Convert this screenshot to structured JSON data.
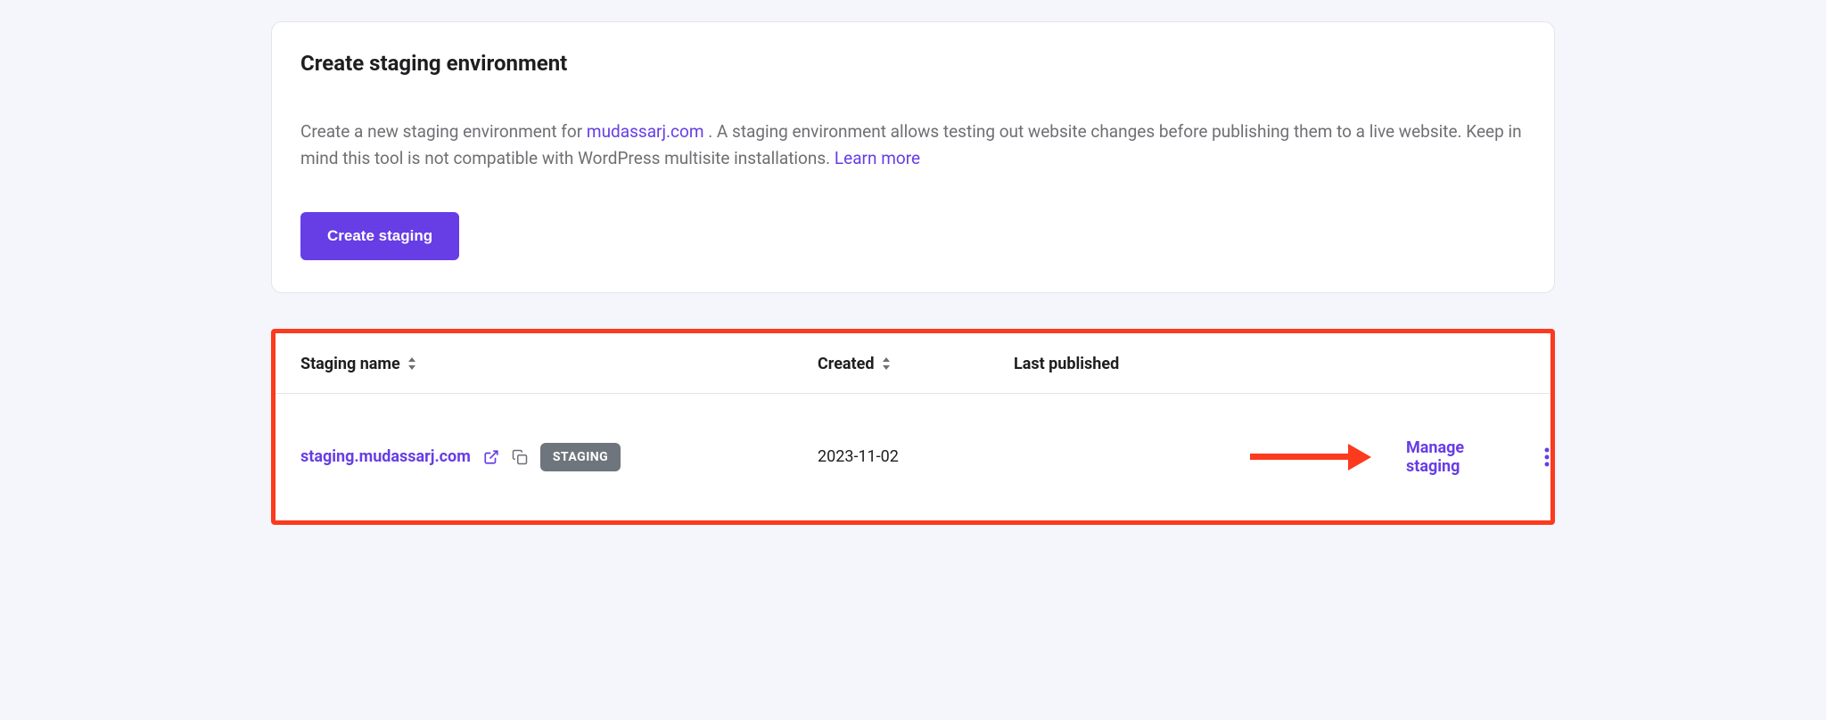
{
  "card": {
    "title": "Create staging environment",
    "desc_prefix": "Create a new staging environment for ",
    "domain": "mudassarj.com",
    "desc_middle": " . A staging environment allows testing out website changes before publishing them to a live website. Keep in mind this tool is not compatible with WordPress multisite installations. ",
    "learn_more": "Learn more",
    "button": "Create staging"
  },
  "table": {
    "headers": {
      "name": "Staging name",
      "created": "Created",
      "last_published": "Last published"
    },
    "rows": [
      {
        "name": "staging.mudassarj.com",
        "badge": "STAGING",
        "created": "2023-11-02",
        "last_published": "",
        "manage": "Manage staging"
      }
    ]
  }
}
